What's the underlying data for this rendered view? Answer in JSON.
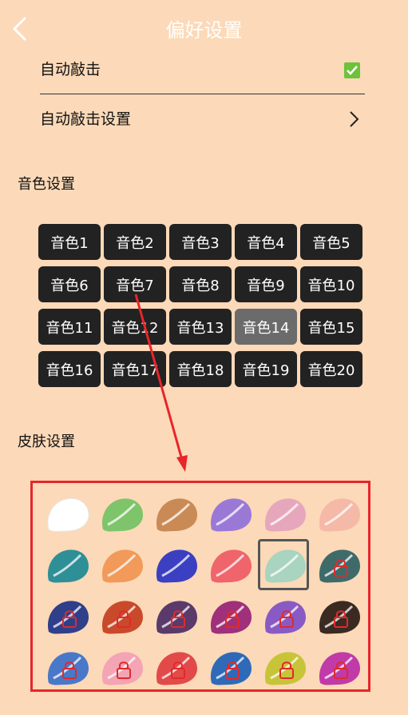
{
  "header": {
    "title": "偏好设置"
  },
  "settings": {
    "auto_tap_label": "自动敲击",
    "auto_tap_checked": true,
    "auto_tap_settings_label": "自动敲击设置"
  },
  "tone_section": {
    "title": "音色设置",
    "selected": "音色14"
  },
  "tones": [
    "音色1",
    "音色2",
    "音色3",
    "音色4",
    "音色5",
    "音色6",
    "音色7",
    "音色8",
    "音色9",
    "音色10",
    "音色11",
    "音色12",
    "音色13",
    "音色14",
    "音色15",
    "音色16",
    "音色17",
    "音色18",
    "音色19",
    "音色20"
  ],
  "skin_section": {
    "title": "皮肤设置"
  },
  "skins": [
    {
      "color": "#ffffff",
      "locked": false
    },
    {
      "color": "#7ec46a",
      "locked": false
    },
    {
      "color": "#c98a55",
      "locked": false
    },
    {
      "color": "#9a79d6",
      "locked": false
    },
    {
      "color": "#e6a7bd",
      "locked": false
    },
    {
      "color": "#f5b9a7",
      "locked": false
    },
    {
      "color": "#2f8f96",
      "locked": false
    },
    {
      "color": "#f29a5a",
      "locked": false
    },
    {
      "color": "#3b3fc2",
      "locked": false
    },
    {
      "color": "#f0646c",
      "locked": false
    },
    {
      "color": "#a8d4c0",
      "locked": false,
      "selected": true
    },
    {
      "color": "#3e6b6a",
      "locked": true
    },
    {
      "color": "#2f3f8a",
      "locked": true
    },
    {
      "color": "#c94a2a",
      "locked": true
    },
    {
      "color": "#5a3a6a",
      "locked": true
    },
    {
      "color": "#a0307a",
      "locked": true
    },
    {
      "color": "#8a5ac4",
      "locked": true
    },
    {
      "color": "#3a2a22",
      "locked": true
    },
    {
      "color": "#4a78c8",
      "locked": true
    },
    {
      "color": "#f3a4b5",
      "locked": true
    },
    {
      "color": "#e24a4a",
      "locked": true
    },
    {
      "color": "#2e6ab8",
      "locked": true
    },
    {
      "color": "#c8c43a",
      "locked": true
    },
    {
      "color": "#c03aa8",
      "locked": true
    }
  ]
}
